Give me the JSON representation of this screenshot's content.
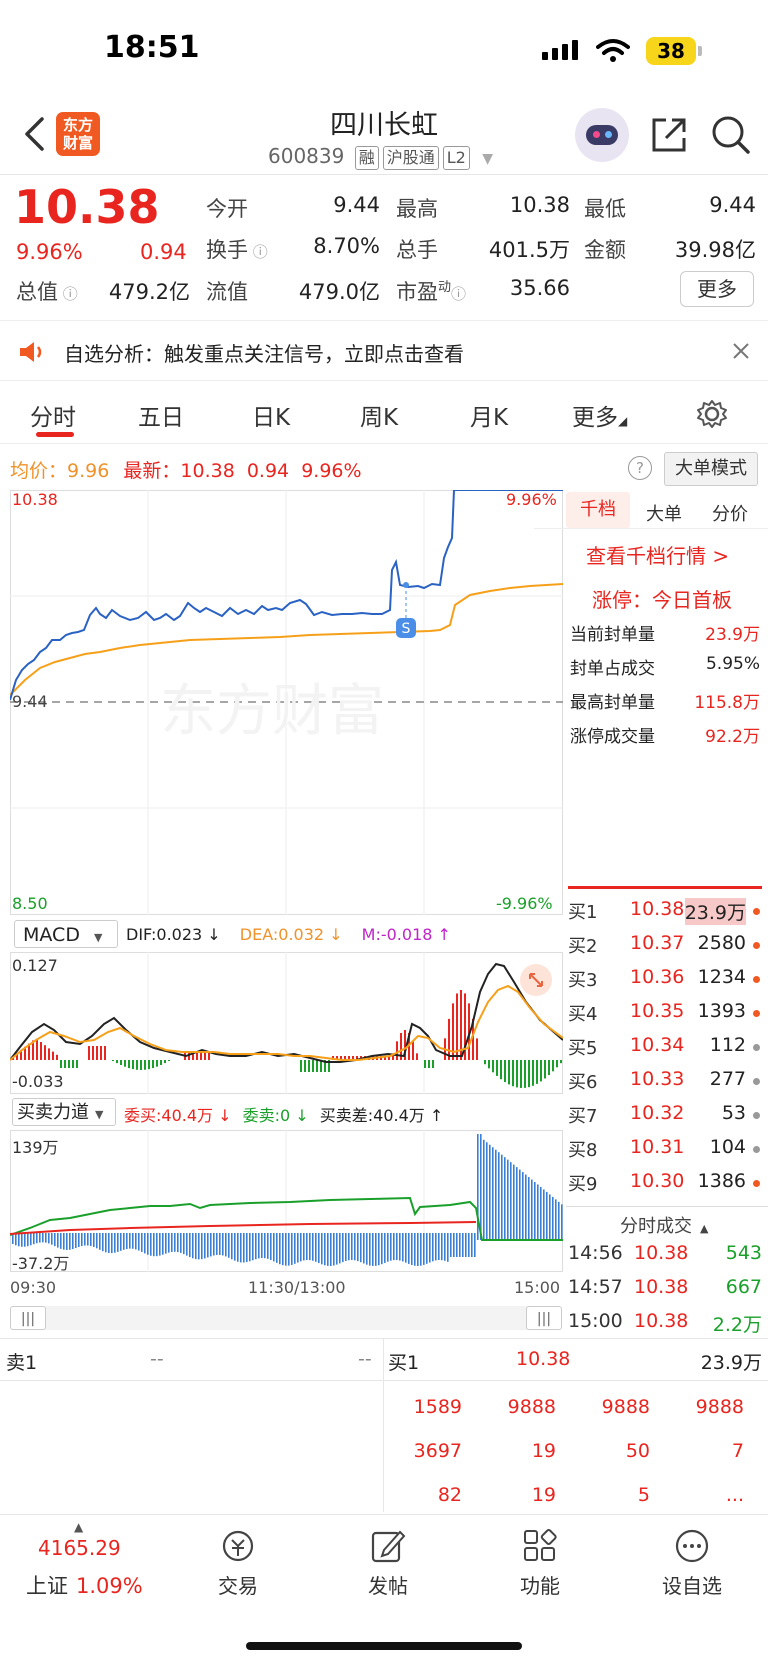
{
  "status_bar": {
    "time": "18:51",
    "battery": "38"
  },
  "header": {
    "back_icon": "chevron-left-icon",
    "logo_line1": "东方",
    "logo_line2": "财富",
    "stock_name": "四川长虹",
    "stock_code": "600839",
    "tags": [
      "融",
      "沪股通",
      "L2"
    ],
    "share_icon": "share-icon",
    "search_icon": "search-icon"
  },
  "quote": {
    "price": "10.38",
    "change_pct": "9.96%",
    "change": "0.94",
    "open_label": "今开",
    "open": "9.44",
    "high_label": "最高",
    "high": "10.38",
    "low_label": "最低",
    "low": "9.44",
    "turnover_label": "换手",
    "turnover": "8.70%",
    "volume_label": "总手",
    "volume": "401.5万",
    "amount_label": "金额",
    "amount": "39.98亿",
    "mktcap_label": "总值",
    "mktcap": "479.2亿",
    "float_label": "流值",
    "float_cap": "479.0亿",
    "pe_label": "市盈",
    "pe_sup": "动",
    "pe": "35.66",
    "more_button": "更多"
  },
  "notice": {
    "text": "自选分析：触发重点关注信号，立即点击查看"
  },
  "tabs": [
    "分时",
    "五日",
    "日K",
    "周K",
    "月K",
    "更多"
  ],
  "intraday": {
    "avg_label": "均价：",
    "avg": "9.96",
    "latest_label": "最新：",
    "latest": "10.38",
    "latest_change": "0.94",
    "latest_pct": "9.96%",
    "big_order_mode": "大单模式",
    "y_top": "10.38",
    "y_mid": "9.44",
    "y_bottom": "8.50",
    "pct_top": "9.96%",
    "pct_bottom": "-9.96%",
    "watermark": "东方财富",
    "signal": "S"
  },
  "side_panel": {
    "tabs": [
      "千档",
      "大单",
      "分价"
    ],
    "view_link": "查看千档行情 >",
    "limit_label": "涨停：今日首板",
    "rows": [
      {
        "label": "当前封单量",
        "value": "23.9万"
      },
      {
        "label": "封单占成交",
        "value": "5.95%"
      },
      {
        "label": "最高封单量",
        "value": "115.8万"
      },
      {
        "label": "涨停成交量",
        "value": "92.2万"
      }
    ]
  },
  "macd": {
    "selector": "MACD",
    "dif": "DIF:0.023 ↓",
    "dea": "DEA:0.032 ↓",
    "m": "M:-0.018 ↑",
    "y_top": "0.127",
    "y_bottom": "-0.033"
  },
  "force": {
    "selector": "买卖力道",
    "buy": "委买:40.4万 ↓",
    "sell": "委卖:0 ↓",
    "diff": "买卖差:40.4万 ↑",
    "y_top": "139万",
    "y_bottom": "-37.2万"
  },
  "time_axis": [
    "09:30",
    "11:30/13:00",
    "15:00"
  ],
  "order_book": [
    {
      "label": "买1",
      "price": "10.38",
      "vol": "23.9万"
    },
    {
      "label": "买2",
      "price": "10.37",
      "vol": "2580"
    },
    {
      "label": "买3",
      "price": "10.36",
      "vol": "1234"
    },
    {
      "label": "买4",
      "price": "10.35",
      "vol": "1393"
    },
    {
      "label": "买5",
      "price": "10.34",
      "vol": "112"
    },
    {
      "label": "买6",
      "price": "10.33",
      "vol": "277"
    },
    {
      "label": "买7",
      "price": "10.32",
      "vol": "53"
    },
    {
      "label": "买8",
      "price": "10.31",
      "vol": "104"
    },
    {
      "label": "买9",
      "price": "10.30",
      "vol": "1386"
    }
  ],
  "ticks": {
    "title": "分时成交",
    "rows": [
      {
        "time": "14:56",
        "price": "10.38",
        "vol": "543"
      },
      {
        "time": "14:57",
        "price": "10.38",
        "vol": "667"
      },
      {
        "time": "15:00",
        "price": "10.38",
        "vol": "2.2万"
      }
    ]
  },
  "queue": {
    "sell_label": "卖1",
    "sell_price": "--",
    "sell_vol": "--",
    "buy_label": "买1",
    "buy_price": "10.38",
    "buy_vol": "23.9万",
    "rows": [
      [
        "1589",
        "9888",
        "9888",
        "9888"
      ],
      [
        "3697",
        "19",
        "50",
        "7"
      ],
      [
        "82",
        "19",
        "5",
        "..."
      ]
    ]
  },
  "bottom_bar": {
    "index_value": "4165.29",
    "index_name": "上证",
    "index_pct": "1.09%",
    "items": [
      "交易",
      "发帖",
      "功能",
      "设自选"
    ]
  }
}
